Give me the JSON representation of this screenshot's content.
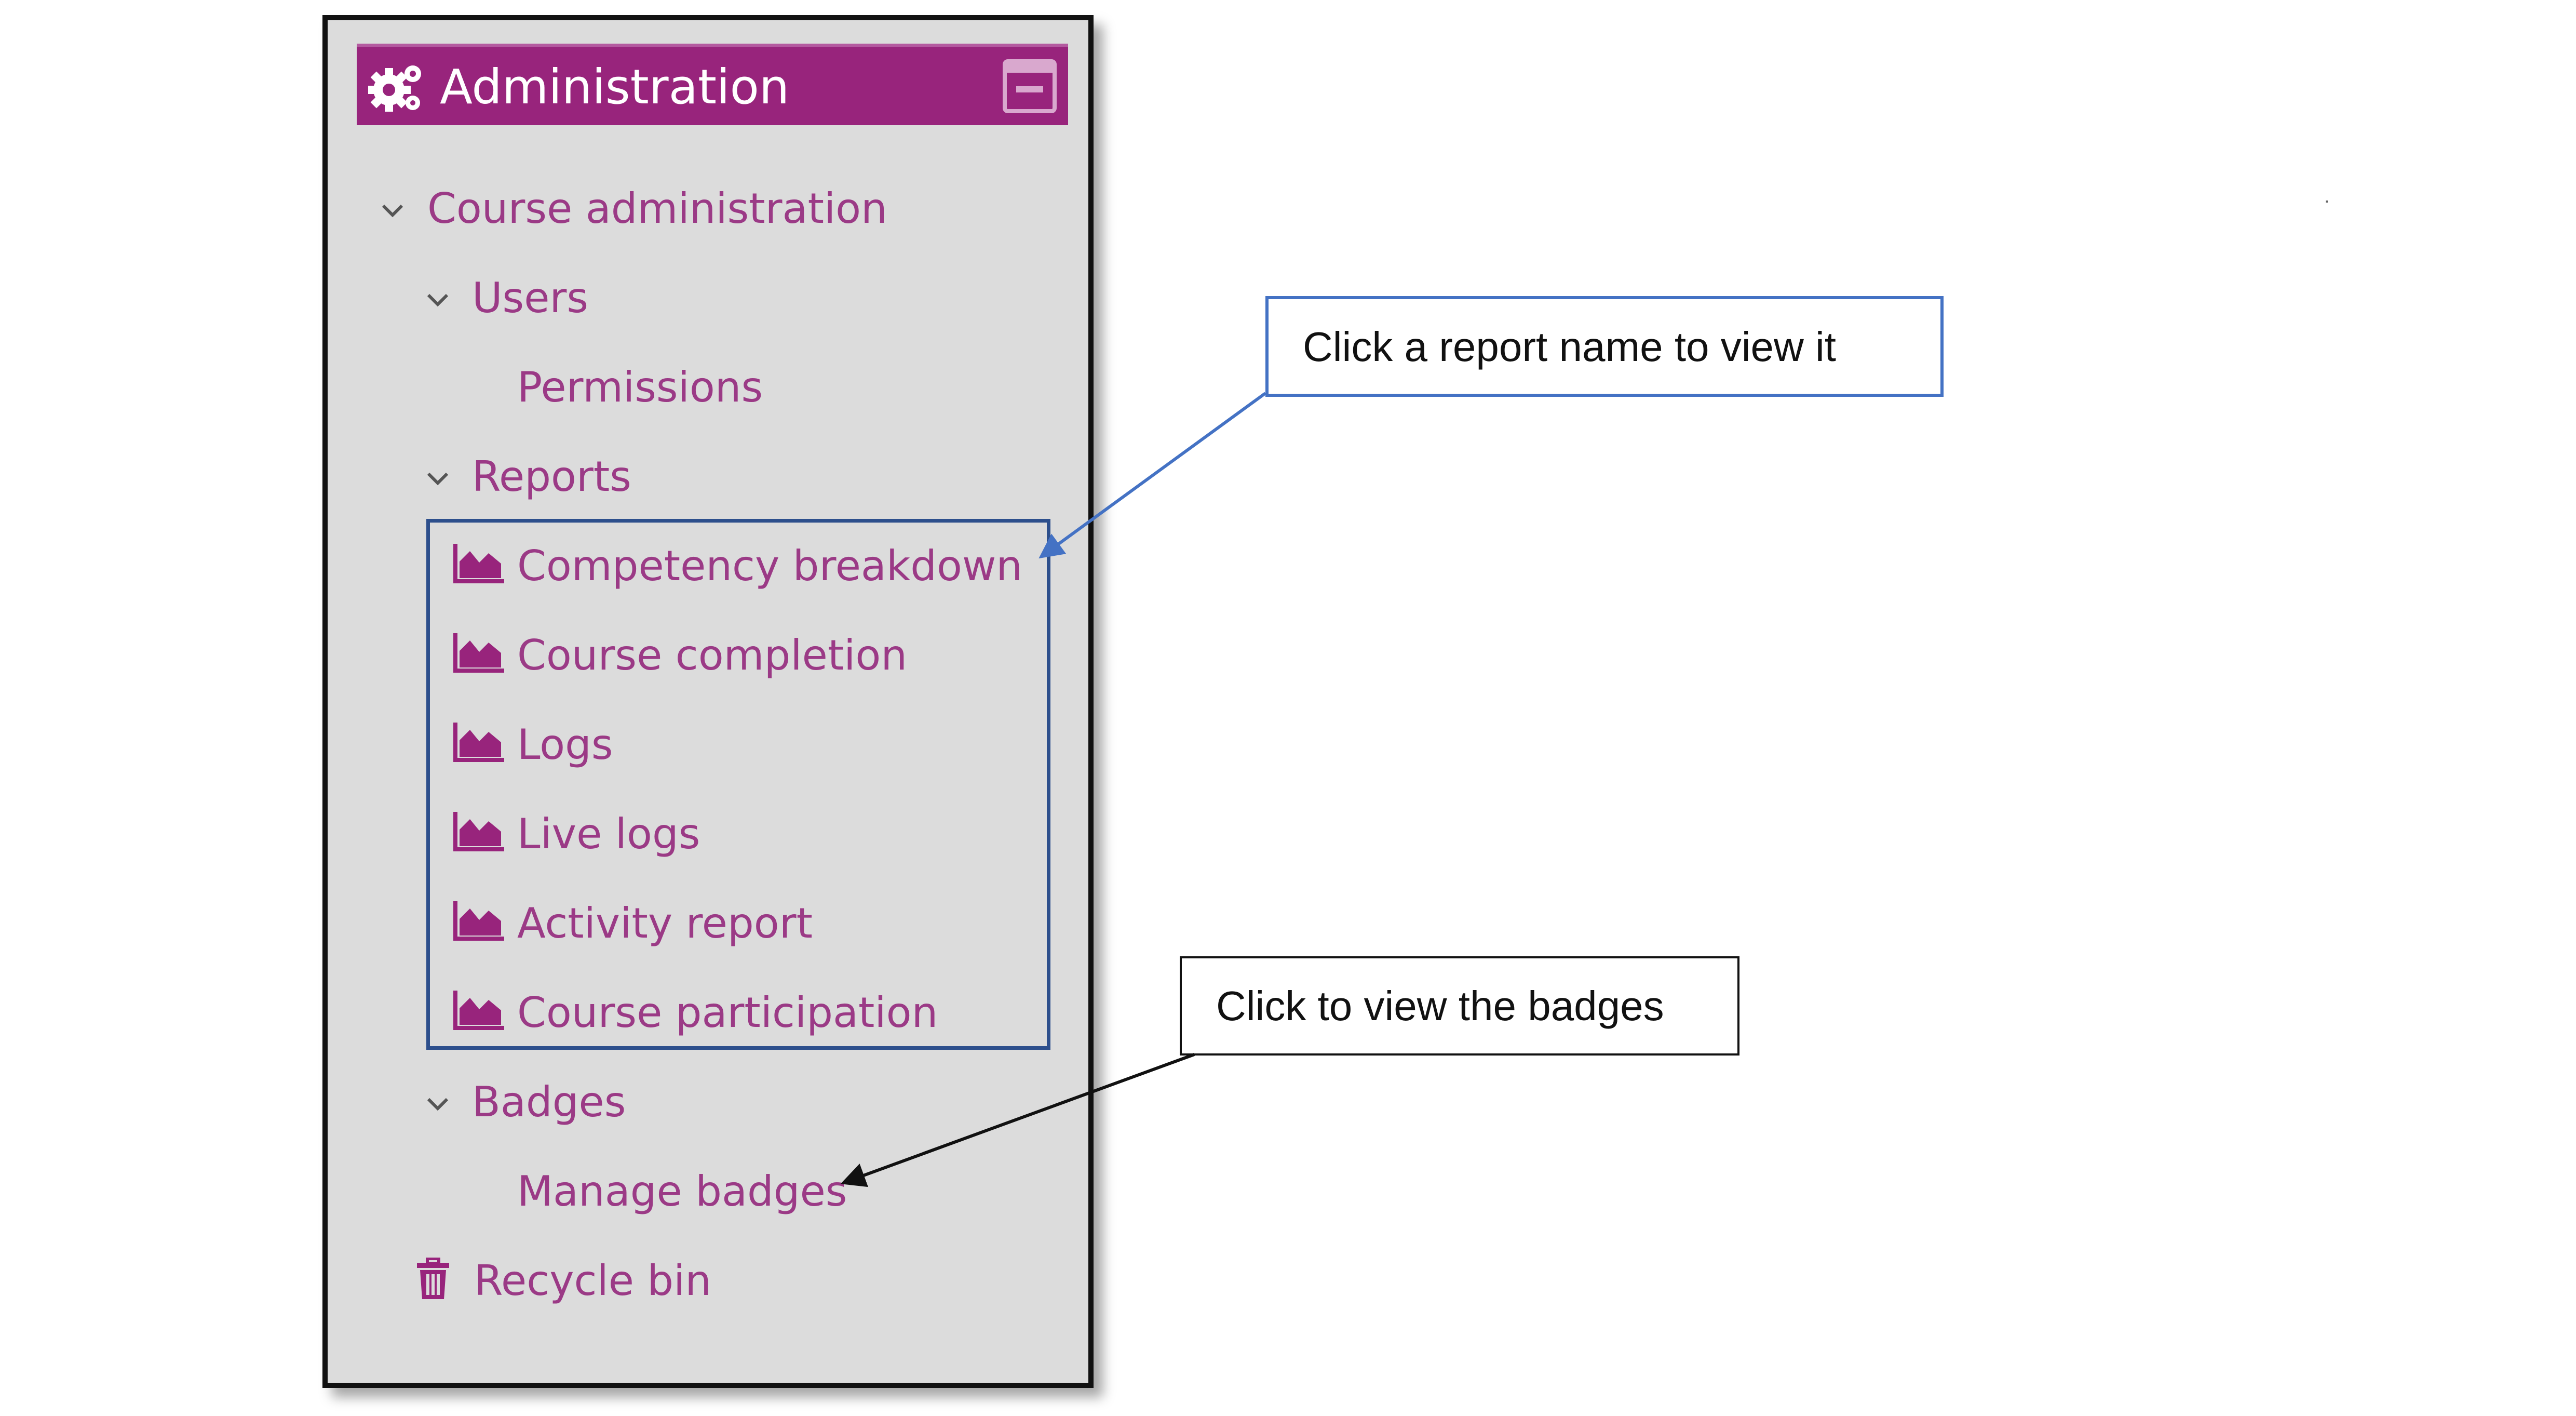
{
  "panel": {
    "title": "Administration",
    "header_color": "#98247c",
    "link_color": "#9b3a86",
    "icons": [
      "cogs-icon",
      "collapse-icon"
    ]
  },
  "tree": {
    "course_administration": "Course administration",
    "users": "Users",
    "permissions": "Permissions",
    "reports": "Reports",
    "report_items": [
      "Competency breakdown",
      "Course completion",
      "Logs",
      "Live logs",
      "Activity report",
      "Course participation"
    ],
    "badges": "Badges",
    "manage_badges": "Manage badges",
    "recycle_bin": "Recycle bin"
  },
  "callouts": {
    "reports_hint": "Click a report name to view it",
    "badges_hint": "Click to view the badges"
  }
}
